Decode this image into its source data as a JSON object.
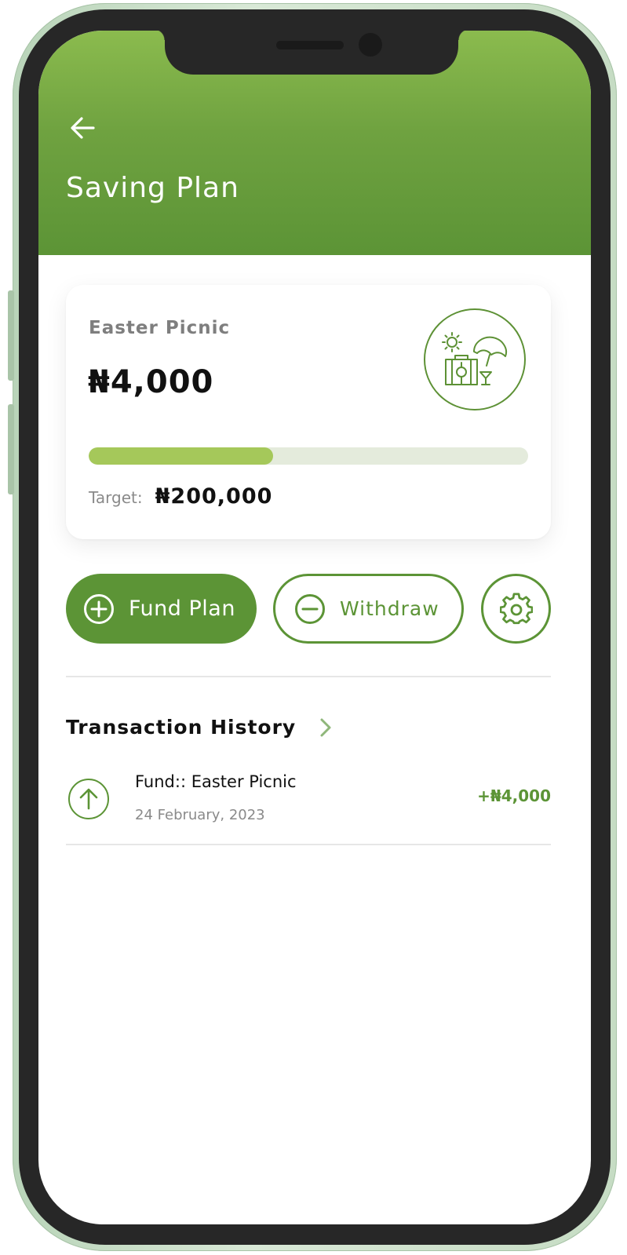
{
  "header": {
    "title": "Saving Plan",
    "background": "#6fa240"
  },
  "plan": {
    "name": "Easter Picnic",
    "amount": "₦4,000",
    "target_label": "Target:",
    "target_value": "₦200,000",
    "progress_fraction": 0.42,
    "icon": "picnic-icon"
  },
  "actions": {
    "fund_label": "Fund Plan",
    "withdraw_label": "Withdraw",
    "fund_icon": "plus-circle-icon",
    "withdraw_icon": "minus-circle-icon",
    "settings_icon": "gear-icon"
  },
  "history": {
    "title": "Transaction History",
    "items": [
      {
        "title": "Fund:: Easter Picnic",
        "date": "24 February, 2023",
        "amount": "+₦4,000",
        "icon": "arrow-up-icon"
      }
    ]
  },
  "colors": {
    "primary": "#5c9436",
    "progress": "#a5c85a",
    "progress_track": "#e4ebdc"
  }
}
